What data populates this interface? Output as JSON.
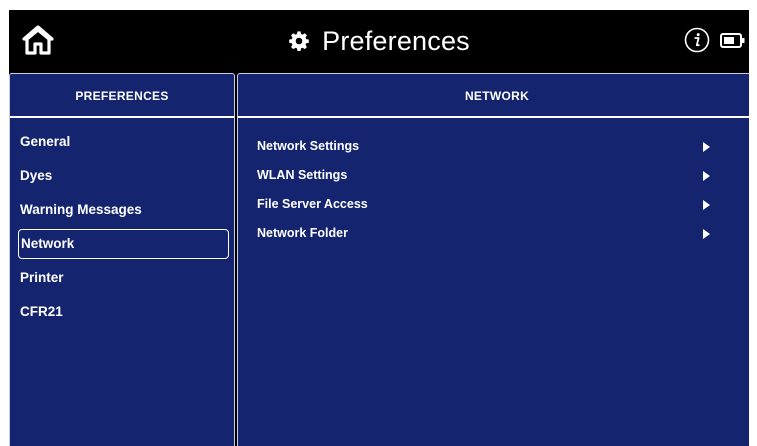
{
  "header": {
    "title": "Preferences",
    "icons": {
      "home": "home-icon",
      "title": "gear-icon",
      "info": "info-icon",
      "battery": "battery-icon"
    }
  },
  "left_panel": {
    "header": "PREFERENCES",
    "items": [
      {
        "label": "General",
        "selected": false
      },
      {
        "label": "Dyes",
        "selected": false
      },
      {
        "label": "Warning Messages",
        "selected": false
      },
      {
        "label": "Network",
        "selected": true
      },
      {
        "label": "Printer",
        "selected": false
      },
      {
        "label": "CFR21",
        "selected": false
      }
    ]
  },
  "right_panel": {
    "header": "NETWORK",
    "items": [
      {
        "label": "Network Settings",
        "icon": "chevron-right-icon"
      },
      {
        "label": "WLAN Settings",
        "icon": "chevron-right-icon"
      },
      {
        "label": "File Server Access",
        "icon": "chevron-right-icon"
      },
      {
        "label": "Network Folder",
        "icon": "chevron-right-icon"
      }
    ]
  },
  "colors": {
    "panel_background": "#14246f",
    "topbar_background": "#000000",
    "text": "#ffffff"
  }
}
